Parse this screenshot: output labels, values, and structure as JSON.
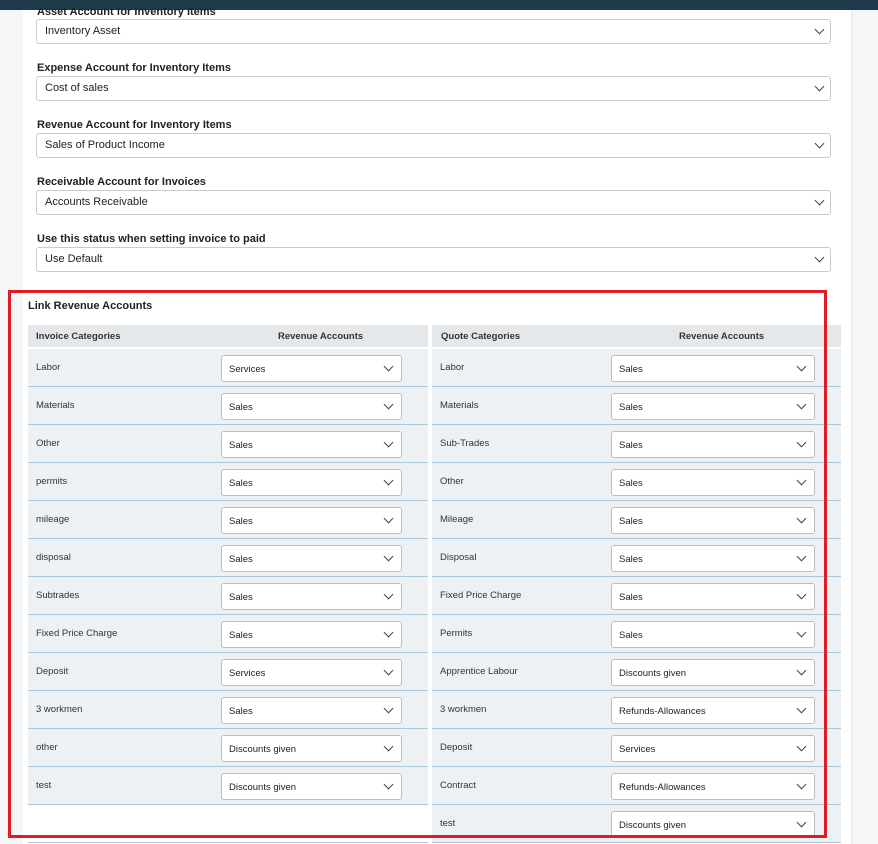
{
  "settings": {
    "asset_label": "Asset Account for Inventory Items",
    "asset_value": "Inventory Asset",
    "expense_label": "Expense Account for Inventory Items",
    "expense_value": "Cost of sales",
    "revenue_label": "Revenue Account for Inventory Items",
    "revenue_value": "Sales of Product Income",
    "receivable_label": "Receivable Account for Invoices",
    "receivable_value": "Accounts Receivable",
    "paid_status_label": "Use this status when setting invoice to paid",
    "paid_status_value": "Use Default"
  },
  "link_revenue": {
    "title": "Link Revenue Accounts",
    "invoice": {
      "col_category": "Invoice Categories",
      "col_account": "Revenue Accounts",
      "rows": [
        {
          "category": "Labor",
          "account": "Services"
        },
        {
          "category": "Materials",
          "account": "Sales"
        },
        {
          "category": "Other",
          "account": "Sales"
        },
        {
          "category": "permits",
          "account": "Sales"
        },
        {
          "category": "mileage",
          "account": "Sales"
        },
        {
          "category": "disposal",
          "account": "Sales"
        },
        {
          "category": "Subtrades",
          "account": "Sales"
        },
        {
          "category": "Fixed Price Charge",
          "account": "Sales"
        },
        {
          "category": "Deposit",
          "account": "Services"
        },
        {
          "category": "3 workmen",
          "account": "Sales"
        },
        {
          "category": "other",
          "account": "Discounts given"
        },
        {
          "category": "test",
          "account": "Discounts given"
        }
      ]
    },
    "quote": {
      "col_category": "Quote Categories",
      "col_account": "Revenue Accounts",
      "rows": [
        {
          "category": "Labor",
          "account": "Sales"
        },
        {
          "category": "Materials",
          "account": "Sales"
        },
        {
          "category": "Sub-Trades",
          "account": "Sales"
        },
        {
          "category": "Other",
          "account": "Sales"
        },
        {
          "category": "Mileage",
          "account": "Sales"
        },
        {
          "category": "Disposal",
          "account": "Sales"
        },
        {
          "category": "Fixed Price Charge",
          "account": "Sales"
        },
        {
          "category": "Permits",
          "account": "Sales"
        },
        {
          "category": "Apprentice Labour",
          "account": "Discounts given"
        },
        {
          "category": "3 workmen",
          "account": "Refunds-Allowances"
        },
        {
          "category": "Deposit",
          "account": "Services"
        },
        {
          "category": "Contract",
          "account": "Refunds-Allowances"
        },
        {
          "category": "test",
          "account": "Discounts given"
        }
      ]
    }
  },
  "colors": {
    "highlight": "#e01b24",
    "row_bg": "#eef1f3",
    "row_divider": "#a9c6da",
    "header_bg": "#e5e8eb",
    "topbar": "#1f3a4a"
  }
}
